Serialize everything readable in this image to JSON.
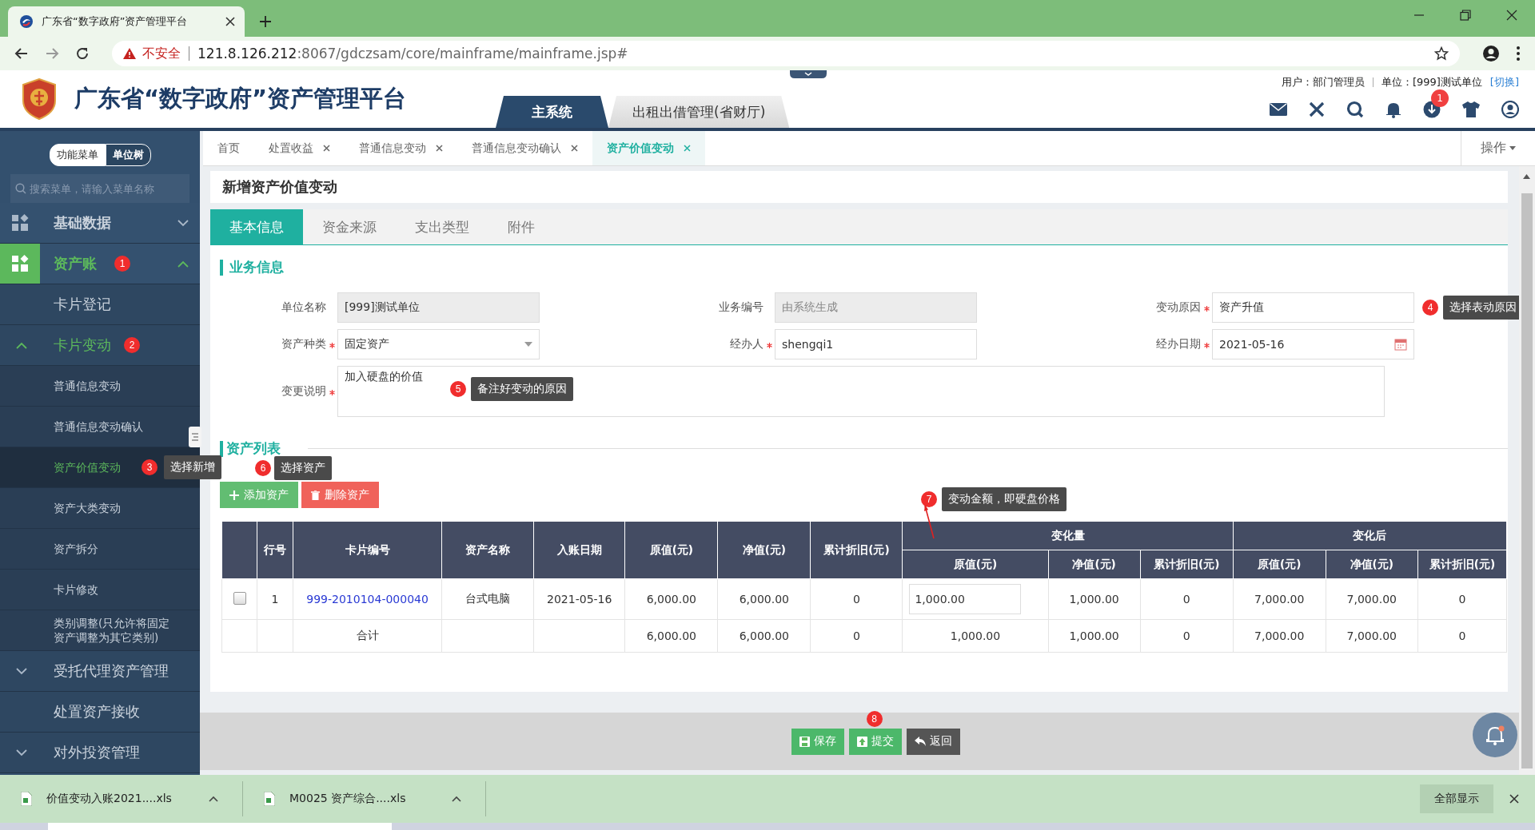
{
  "browser": {
    "tab_title": "广东省“数字政府”资产管理平台",
    "insecure_label": "不安全",
    "url_host": "121.8.126.212",
    "url_path": ":8067/gdczsam/core/mainframe/mainframe.jsp#"
  },
  "header": {
    "title": "广东省“数字政府”资产管理平台",
    "system_tabs": [
      {
        "label": "主系统",
        "selected": true
      },
      {
        "label": "出租出借管理(省财厅)",
        "selected": false
      }
    ],
    "user_label": "用户：部门管理员",
    "unit_label": "单位：[999]测试单位",
    "switch_link": "[切换]",
    "download_count": "1"
  },
  "sidebar": {
    "mode_toggle": [
      {
        "label": "功能菜单",
        "selected": false
      },
      {
        "label": "单位树",
        "selected": true
      }
    ],
    "search_placeholder": "搜索菜单，请输入菜单名称",
    "items": [
      {
        "label": "基础数据",
        "expanded": false
      },
      {
        "label": "资产账",
        "expanded": true,
        "step": "1",
        "children": [
          {
            "label": "卡片登记"
          },
          {
            "label": "卡片变动",
            "expanded": true,
            "step": "2",
            "children": [
              {
                "label": "普通信息变动",
                "selected": false
              },
              {
                "label": "普通信息变动确认",
                "selected": false
              },
              {
                "label": "资产价值变动",
                "selected": true,
                "step": "3",
                "tip": "选择新增"
              },
              {
                "label": "资产大类变动",
                "selected": false
              },
              {
                "label": "资产拆分",
                "selected": false
              },
              {
                "label": "卡片修改",
                "selected": false
              },
              {
                "label": "类别调整(只允许将固定资产调整为其它类别)",
                "selected": false
              }
            ]
          },
          {
            "label": "受托代理资产管理",
            "expanded": false
          },
          {
            "label": "处置资产接收"
          },
          {
            "label": "对外投资管理",
            "expanded": false
          }
        ]
      }
    ]
  },
  "page_tabs": [
    {
      "label": "首页",
      "closable": false,
      "selected": false
    },
    {
      "label": "处置收益",
      "closable": true,
      "selected": false
    },
    {
      "label": "普通信息变动",
      "closable": true,
      "selected": false
    },
    {
      "label": "普通信息变动确认",
      "closable": true,
      "selected": false
    },
    {
      "label": "资产价值变动",
      "closable": true,
      "selected": true
    }
  ],
  "operations_menu": "操作",
  "form": {
    "title": "新增资产价值变动",
    "tabs": [
      {
        "label": "基本信息",
        "selected": true
      },
      {
        "label": "资金来源",
        "selected": false
      },
      {
        "label": "支出类型",
        "selected": false
      },
      {
        "label": "附件",
        "selected": false
      }
    ],
    "section_title": "业务信息",
    "fields": [
      {
        "label": "单位名称",
        "kind": "readonly",
        "required": false,
        "value": "[999]测试单位"
      },
      {
        "label": "业务编号",
        "kind": "readonly",
        "required": false,
        "placeholder": "由系统生成"
      },
      {
        "label": "变动原因",
        "kind": "text",
        "required": true,
        "value": "资产升值",
        "step": "4",
        "tip": "选择表动原因"
      },
      {
        "label": "资产种类",
        "kind": "select",
        "required": true,
        "value": "固定资产"
      },
      {
        "label": "经办人",
        "kind": "text",
        "required": true,
        "value": "shengqi1"
      },
      {
        "label": "经办日期",
        "kind": "date",
        "required": true,
        "value": "2021-05-16"
      },
      {
        "label": "变更说明",
        "kind": "textarea",
        "required": true,
        "value": "加入硬盘的价值",
        "step": "5",
        "tip": "备注好变动的原因"
      }
    ]
  },
  "asset_list": {
    "title": "资产列表",
    "buttons": [
      {
        "label": "添加资产",
        "kind": "add",
        "step": "6",
        "tip": "选择资产"
      },
      {
        "label": "删除资产",
        "kind": "delete"
      }
    ],
    "change_step": "7",
    "change_tip": "变动金额，即硬盘价格",
    "group_headers": [
      "变化量",
      "变化后"
    ],
    "columns": [
      "行号",
      "卡片编号",
      "资产名称",
      "入账日期",
      "原值(元)",
      "净值(元)",
      "累计折旧(元)"
    ],
    "sub_columns": [
      "原值(元)",
      "净值(元)",
      "累计折旧(元)",
      "原值(元)",
      "净值(元)",
      "累计折旧(元)"
    ],
    "rows": [
      {
        "checked": false,
        "cells": [
          "1",
          "999-2010104-000040",
          "台式电脑",
          "2021-05-16",
          "6,000.00",
          "6,000.00",
          "0",
          "1,000.00",
          "1,000.00",
          "0",
          "7,000.00",
          "7,000.00",
          "0"
        ]
      }
    ],
    "total": {
      "label": "合计",
      "cells": [
        "6,000.00",
        "6,000.00",
        "0",
        "1,000.00",
        "1,000.00",
        "0",
        "7,000.00",
        "7,000.00",
        "0"
      ]
    }
  },
  "footer_buttons": [
    {
      "label": "保存",
      "kind": "save"
    },
    {
      "label": "提交",
      "kind": "submit",
      "step": "8"
    },
    {
      "label": "返回",
      "kind": "back"
    }
  ],
  "downloads": {
    "files": [
      "价值变动入账2021....xls",
      "M0025 资产综合....xls"
    ],
    "show_all": "全部显示"
  }
}
